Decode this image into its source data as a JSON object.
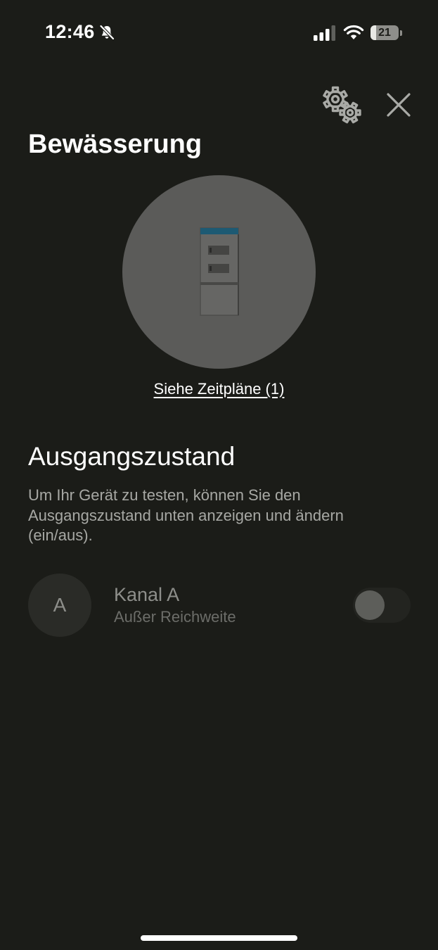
{
  "status_bar": {
    "time": "12:46",
    "battery_level": "21",
    "battery_fraction": 0.21,
    "icons": [
      "bell-slash-icon",
      "cellular-signal-icon",
      "wifi-icon",
      "battery-icon"
    ]
  },
  "header": {
    "title": "Bewässerung",
    "settings_icon": "gears-icon",
    "close_icon": "close-icon"
  },
  "device": {
    "image": "irrigation-controller-icon",
    "schedules_link": "Siehe Zeitpläne (1)"
  },
  "output_state": {
    "title": "Ausgangszustand",
    "description": "Um Ihr Gerät zu testen, können Sie den Ausgangszustand unten anzeigen und ändern (ein/aus)."
  },
  "channels": [
    {
      "avatar_letter": "A",
      "name": "Kanal A",
      "status": "Außer Reichweite",
      "toggle_on": false
    }
  ],
  "colors": {
    "background": "#1b1c18",
    "circle": "#5b5b59",
    "device_accent": "#1d5a73",
    "description_text": "#a7a8a4",
    "disabled_text": "#8d8e8a"
  }
}
